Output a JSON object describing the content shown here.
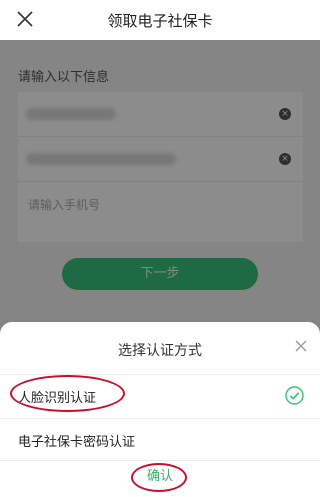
{
  "header": {
    "title": "领取电子社保卡"
  },
  "form": {
    "section_title": "请输入以下信息",
    "phone_placeholder": "请输入手机号",
    "next_label": "下一步"
  },
  "sheet": {
    "title": "选择认证方式",
    "options": [
      {
        "label": "人脸识别认证",
        "selected": true
      },
      {
        "label": "电子社保卡密码认证",
        "selected": false
      }
    ],
    "confirm_label": "确认"
  },
  "colors": {
    "accent": "#35c27a",
    "confirm_text": "#35b06a",
    "annotation": "#c8102e"
  }
}
